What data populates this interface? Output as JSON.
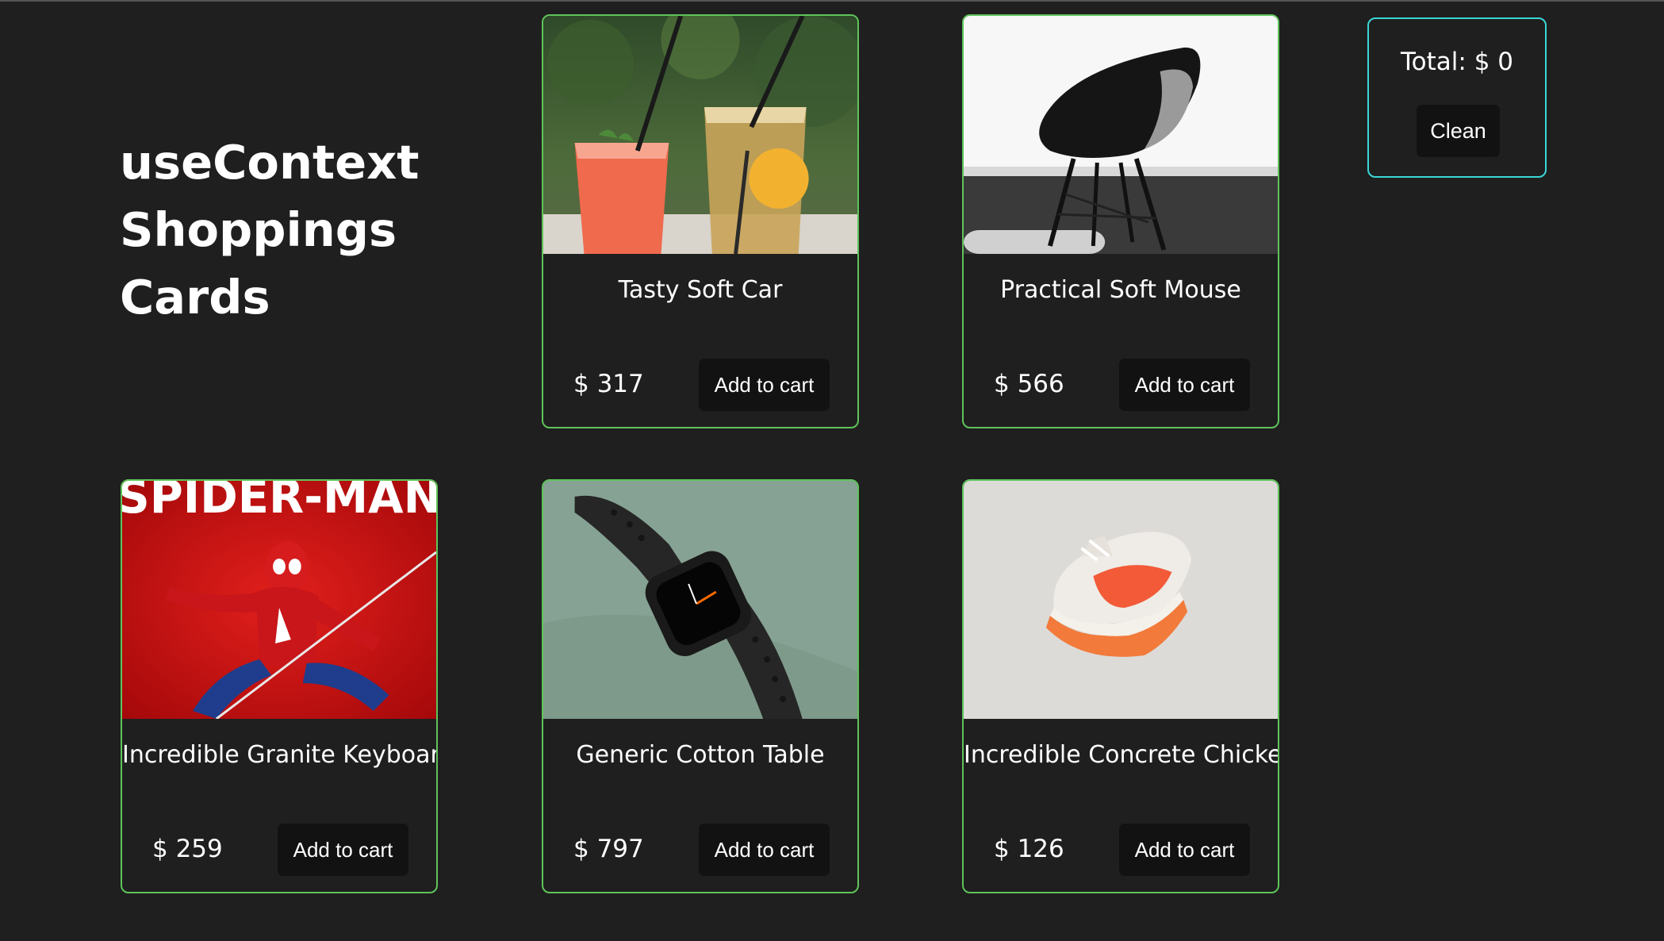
{
  "page": {
    "title": "useContext Shoppings Cards"
  },
  "cart": {
    "total_label": "Total: $ 0",
    "clean_label": "Clean"
  },
  "products": [
    {
      "name": "Tasty Soft Car",
      "price": "$ 317",
      "button": "Add to cart",
      "image_icon": "drinks-photo"
    },
    {
      "name": "Practical Soft Mouse",
      "price": "$ 566",
      "button": "Add to cart",
      "image_icon": "chair-photo"
    },
    {
      "name": "Incredible Granite Keyboard",
      "price": "$ 259",
      "button": "Add to cart",
      "image_icon": "spiderman-photo",
      "image_text": "SPIDER-MAN"
    },
    {
      "name": "Generic Cotton Table",
      "price": "$ 797",
      "button": "Add to cart",
      "image_icon": "watch-photo"
    },
    {
      "name": "Incredible Concrete Chicken",
      "price": "$ 126",
      "button": "Add to cart",
      "image_icon": "sneaker-photo"
    }
  ],
  "colors": {
    "background": "#1f1f1f",
    "card_border": "#5fc45a",
    "cart_border": "#3ad6d6",
    "button_bg": "#121212"
  }
}
